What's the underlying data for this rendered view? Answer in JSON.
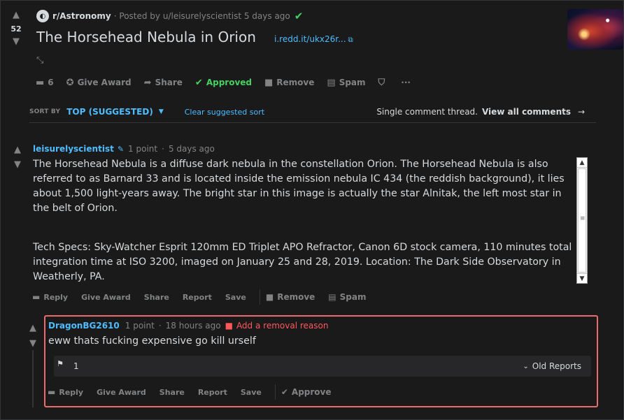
{
  "post": {
    "score": "52",
    "subreddit": "r/Astronomy",
    "posted_by": "· Posted by u/leisurelyscientist 5 days ago",
    "title": "The Horsehead Nebula in Orion",
    "link": "i.redd.it/ukx26r...",
    "actions": {
      "comments": "6",
      "give_award": "Give Award",
      "share": "Share",
      "approved": "Approved",
      "remove": "Remove",
      "spam": "Spam",
      "more": "···"
    }
  },
  "sort": {
    "label": "SORT BY",
    "value": "TOP (SUGGESTED)",
    "clear": "Clear suggested sort",
    "single_thread": "Single comment thread.",
    "view_all": "View all comments"
  },
  "comment1": {
    "author": "leisurelyscientist",
    "points": "1 point",
    "time": "5 days ago",
    "paragraph1": "The Horsehead Nebula is a diffuse dark nebula in the constellation Orion. The Horsehead Nebula is also referred to as Barnard 33 and is located inside the emission nebula IC 434 (the reddish background), it lies about 1,500 light-years away. The bright star in this image is actually the star Alnitak, the left most star in the belt of Orion.",
    "paragraph2": "Tech Specs: Sky-Watcher Esprit 120mm ED Triplet APO Refractor, Canon 6D stock camera, 110 minutes total integration time at ISO 3200, imaged on January 25 and 28, 2019. Location: The Dark Side Observatory in Weatherly, PA.",
    "actions": {
      "reply": "Reply",
      "give_award": "Give Award",
      "share": "Share",
      "report": "Report",
      "save": "Save",
      "remove": "Remove",
      "spam": "Spam"
    }
  },
  "comment2": {
    "author": "DragonBG2610",
    "points": "1 point",
    "time": "18 hours ago",
    "removal_reason": "Add a removal reason",
    "body": "eww thats fucking expensive go kill urself",
    "report_count": "1",
    "old_reports": "Old Reports",
    "actions": {
      "reply": "Reply",
      "give_award": "Give Award",
      "share": "Share",
      "report": "Report",
      "save": "Save",
      "approve": "Approve"
    }
  },
  "colors": {
    "background": "#1a1a1b",
    "link_blue": "#4fbcff",
    "approved_green": "#46d160",
    "report_red": "#ea6c6c"
  },
  "icons": [
    "upvote-icon",
    "downvote-icon",
    "checkmark-icon",
    "external-link-icon",
    "expand-icon",
    "comment-icon",
    "award-icon",
    "share-icon",
    "trash-icon",
    "spam-icon",
    "shield-icon",
    "more-icon",
    "caret-down-icon",
    "arrow-right-icon",
    "pencil-mod-icon",
    "flag-icon",
    "chevron-down-icon"
  ]
}
